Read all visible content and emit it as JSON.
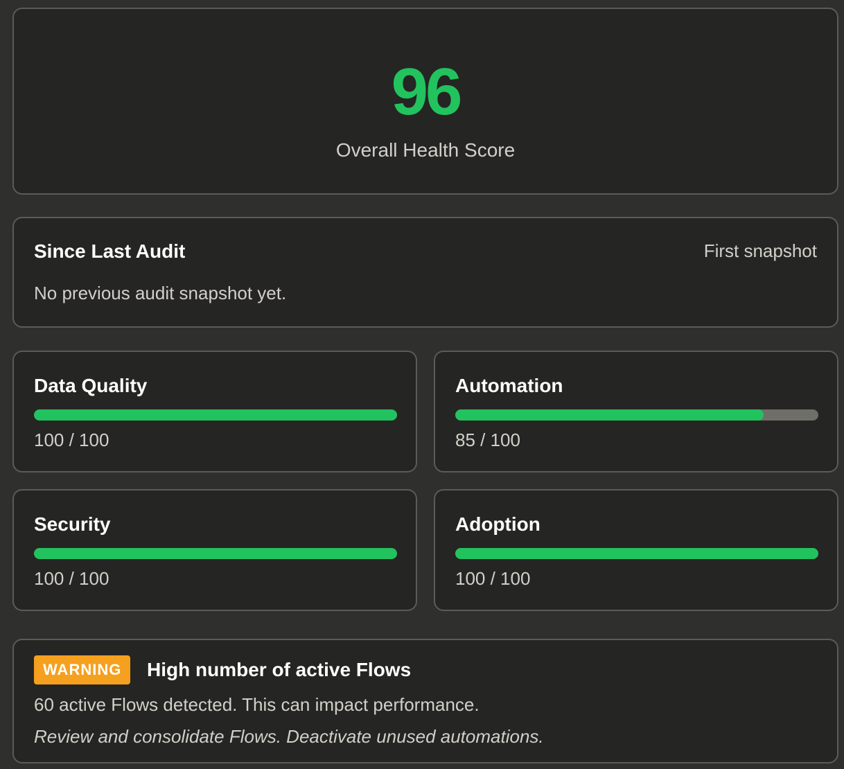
{
  "colors": {
    "accent_green": "#22c35e",
    "track_gray": "#6f6e69",
    "warning_orange": "#f5a01e"
  },
  "score": {
    "value": "96",
    "label": "Overall Health Score"
  },
  "since_last_audit": {
    "title": "Since Last Audit",
    "tag": "First snapshot",
    "message": "No previous audit snapshot yet."
  },
  "metrics": [
    {
      "title": "Data Quality",
      "value_text": "100 / 100",
      "score": 100
    },
    {
      "title": "Automation",
      "value_text": "85 / 100",
      "score": 85
    },
    {
      "title": "Security",
      "value_text": "100 / 100",
      "score": 100
    },
    {
      "title": "Adoption",
      "value_text": "100 / 100",
      "score": 100
    }
  ],
  "warning": {
    "badge": "WARNING",
    "title": "High number of active Flows",
    "description": "60 active Flows detected. This can impact performance.",
    "recommendation": "Review and consolidate Flows. Deactivate unused automations."
  }
}
